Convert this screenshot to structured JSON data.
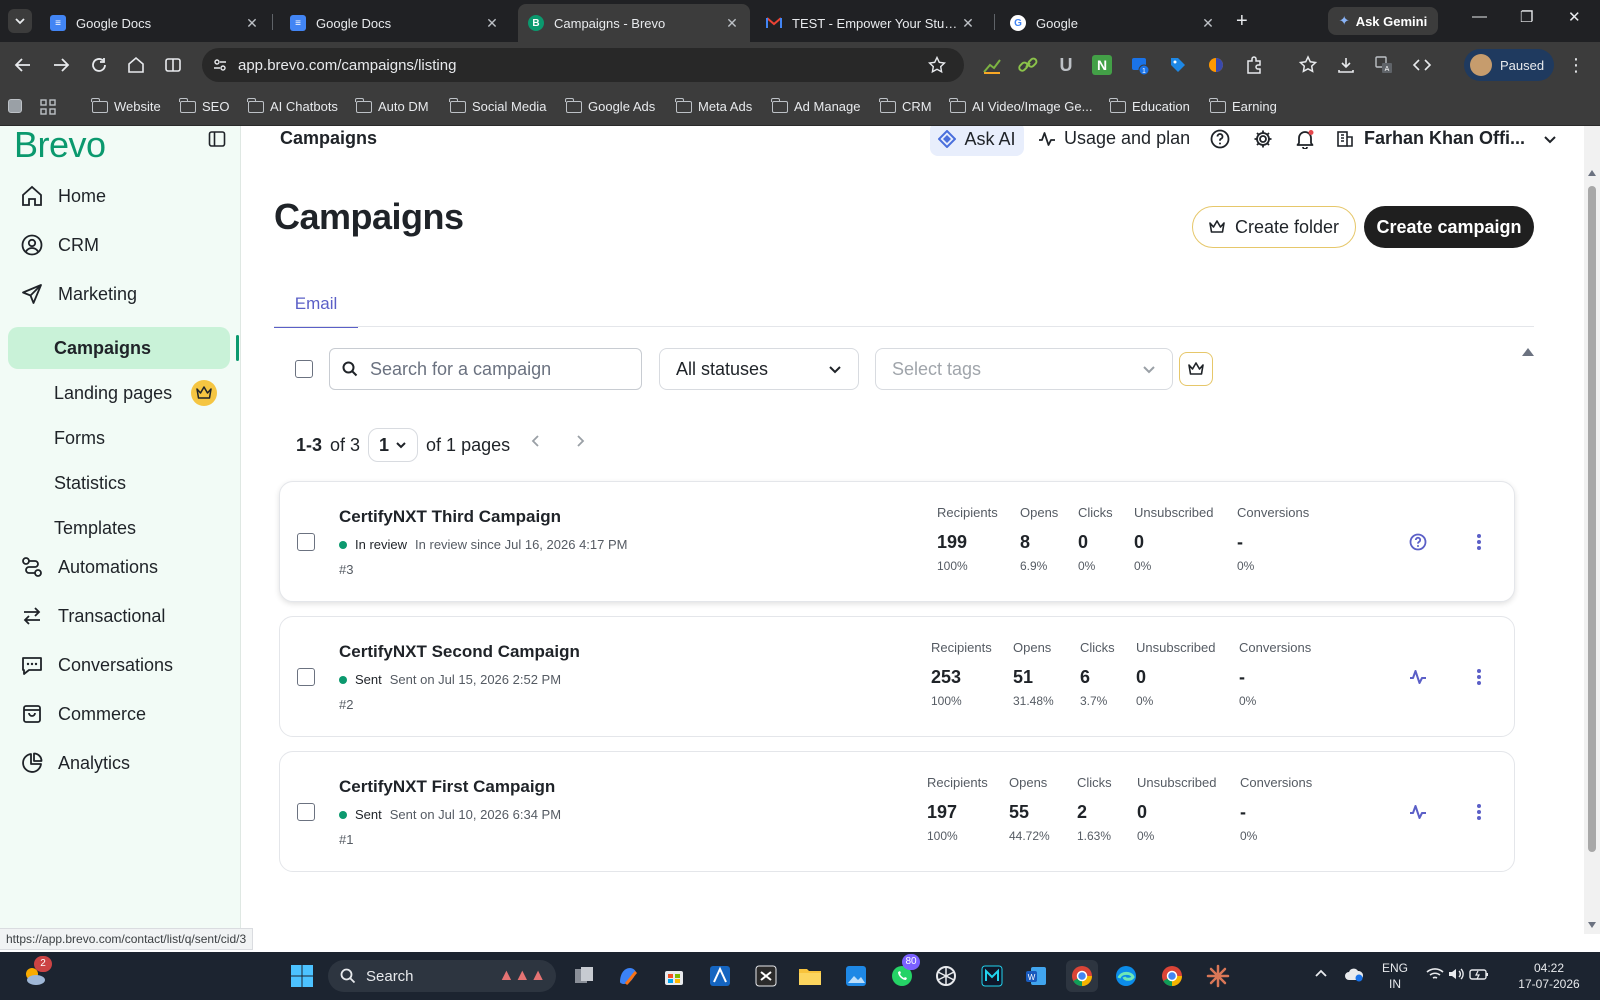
{
  "browser": {
    "tabs": [
      {
        "title": "Google Docs",
        "icon": "docs-icon"
      },
      {
        "title": "Google Docs",
        "icon": "docs-icon"
      },
      {
        "title": "Campaigns - Brevo",
        "icon": "brevo-icon",
        "active": true
      },
      {
        "title": "TEST - Empower Your Student",
        "icon": "gmail-icon"
      },
      {
        "title": "Google",
        "icon": "google-icon"
      }
    ],
    "gemini_label": "Ask Gemini",
    "url": "app.brevo.com/campaigns/listing",
    "profile_label": "Paused",
    "bookmarks": [
      "Website",
      "SEO",
      "AI Chatbots",
      "Auto DM",
      "Social Media",
      "Google Ads",
      "Meta Ads",
      "Ad Manage",
      "CRM",
      "AI Video/Image Ge...",
      "Education",
      "Earning"
    ],
    "status_url": "https://app.brevo.com/contact/list/q/sent/cid/3"
  },
  "sidebar": {
    "logo": "Brevo",
    "nav": [
      {
        "label": "Home",
        "icon": "home-icon"
      },
      {
        "label": "CRM",
        "icon": "crm-icon"
      },
      {
        "label": "Marketing",
        "icon": "send-icon"
      },
      {
        "label": "Automations",
        "icon": "automations-icon"
      },
      {
        "label": "Transactional",
        "icon": "transactional-icon"
      },
      {
        "label": "Conversations",
        "icon": "chat-icon"
      },
      {
        "label": "Commerce",
        "icon": "bag-icon"
      },
      {
        "label": "Analytics",
        "icon": "pie-icon"
      }
    ],
    "marketing_sub": [
      "Campaigns",
      "Landing pages",
      "Forms",
      "Statistics",
      "Templates"
    ]
  },
  "topbar": {
    "title": "Campaigns",
    "ask_ai": "Ask AI",
    "usage": "Usage and plan",
    "account": "Farhan Khan Offi..."
  },
  "page": {
    "title": "Campaigns",
    "create_folder": "Create folder",
    "create_campaign": "Create campaign",
    "tab_email": "Email",
    "search_placeholder": "Search for a campaign",
    "status_filter": "All statuses",
    "tags_placeholder": "Select tags",
    "range": "1-3",
    "of_total": "of 3",
    "page_value": "1",
    "of_pages": "of 1 pages"
  },
  "metric_labels": [
    "Recipients",
    "Opens",
    "Clicks",
    "Unsubscribed",
    "Conversions"
  ],
  "campaigns": [
    {
      "name": "CertifyNXT Third Campaign",
      "status": "In review",
      "status_detail": "In review since Jul 16, 2026 4:17 PM",
      "number": "#3",
      "metrics": [
        {
          "value": "199",
          "pct": "100%"
        },
        {
          "value": "8",
          "pct": "6.9%"
        },
        {
          "value": "0",
          "pct": "0%"
        },
        {
          "value": "0",
          "pct": "0%"
        },
        {
          "value": "-",
          "pct": "0%"
        }
      ],
      "action_icon": "help-icon"
    },
    {
      "name": "CertifyNXT Second Campaign",
      "status": "Sent",
      "status_detail": "Sent on Jul 15, 2026 2:52 PM",
      "number": "#2",
      "metrics": [
        {
          "value": "253",
          "pct": "100%"
        },
        {
          "value": "51",
          "pct": "31.48%"
        },
        {
          "value": "6",
          "pct": "3.7%"
        },
        {
          "value": "0",
          "pct": "0%"
        },
        {
          "value": "-",
          "pct": "0%"
        }
      ],
      "action_icon": "activity-icon"
    },
    {
      "name": "CertifyNXT First Campaign",
      "status": "Sent",
      "status_detail": "Sent on Jul 10, 2026 6:34 PM",
      "number": "#1",
      "metrics": [
        {
          "value": "197",
          "pct": "100%"
        },
        {
          "value": "55",
          "pct": "44.72%"
        },
        {
          "value": "2",
          "pct": "1.63%"
        },
        {
          "value": "0",
          "pct": "0%"
        },
        {
          "value": "-",
          "pct": "0%"
        }
      ],
      "action_icon": "activity-icon"
    }
  ],
  "taskbar": {
    "search_label": "Search",
    "weather_badge": "2",
    "whatsapp_badge": "80",
    "lang_line1": "ENG",
    "lang_line2": "IN",
    "time": "04:22",
    "date": "17-07-2026"
  },
  "colors": {
    "brand": "#0b996e",
    "accent": "#5b5fc7",
    "status_green": "#0b996e",
    "sidebar_bg": "#f2fbf6",
    "active_item": "#c9f2d8"
  }
}
